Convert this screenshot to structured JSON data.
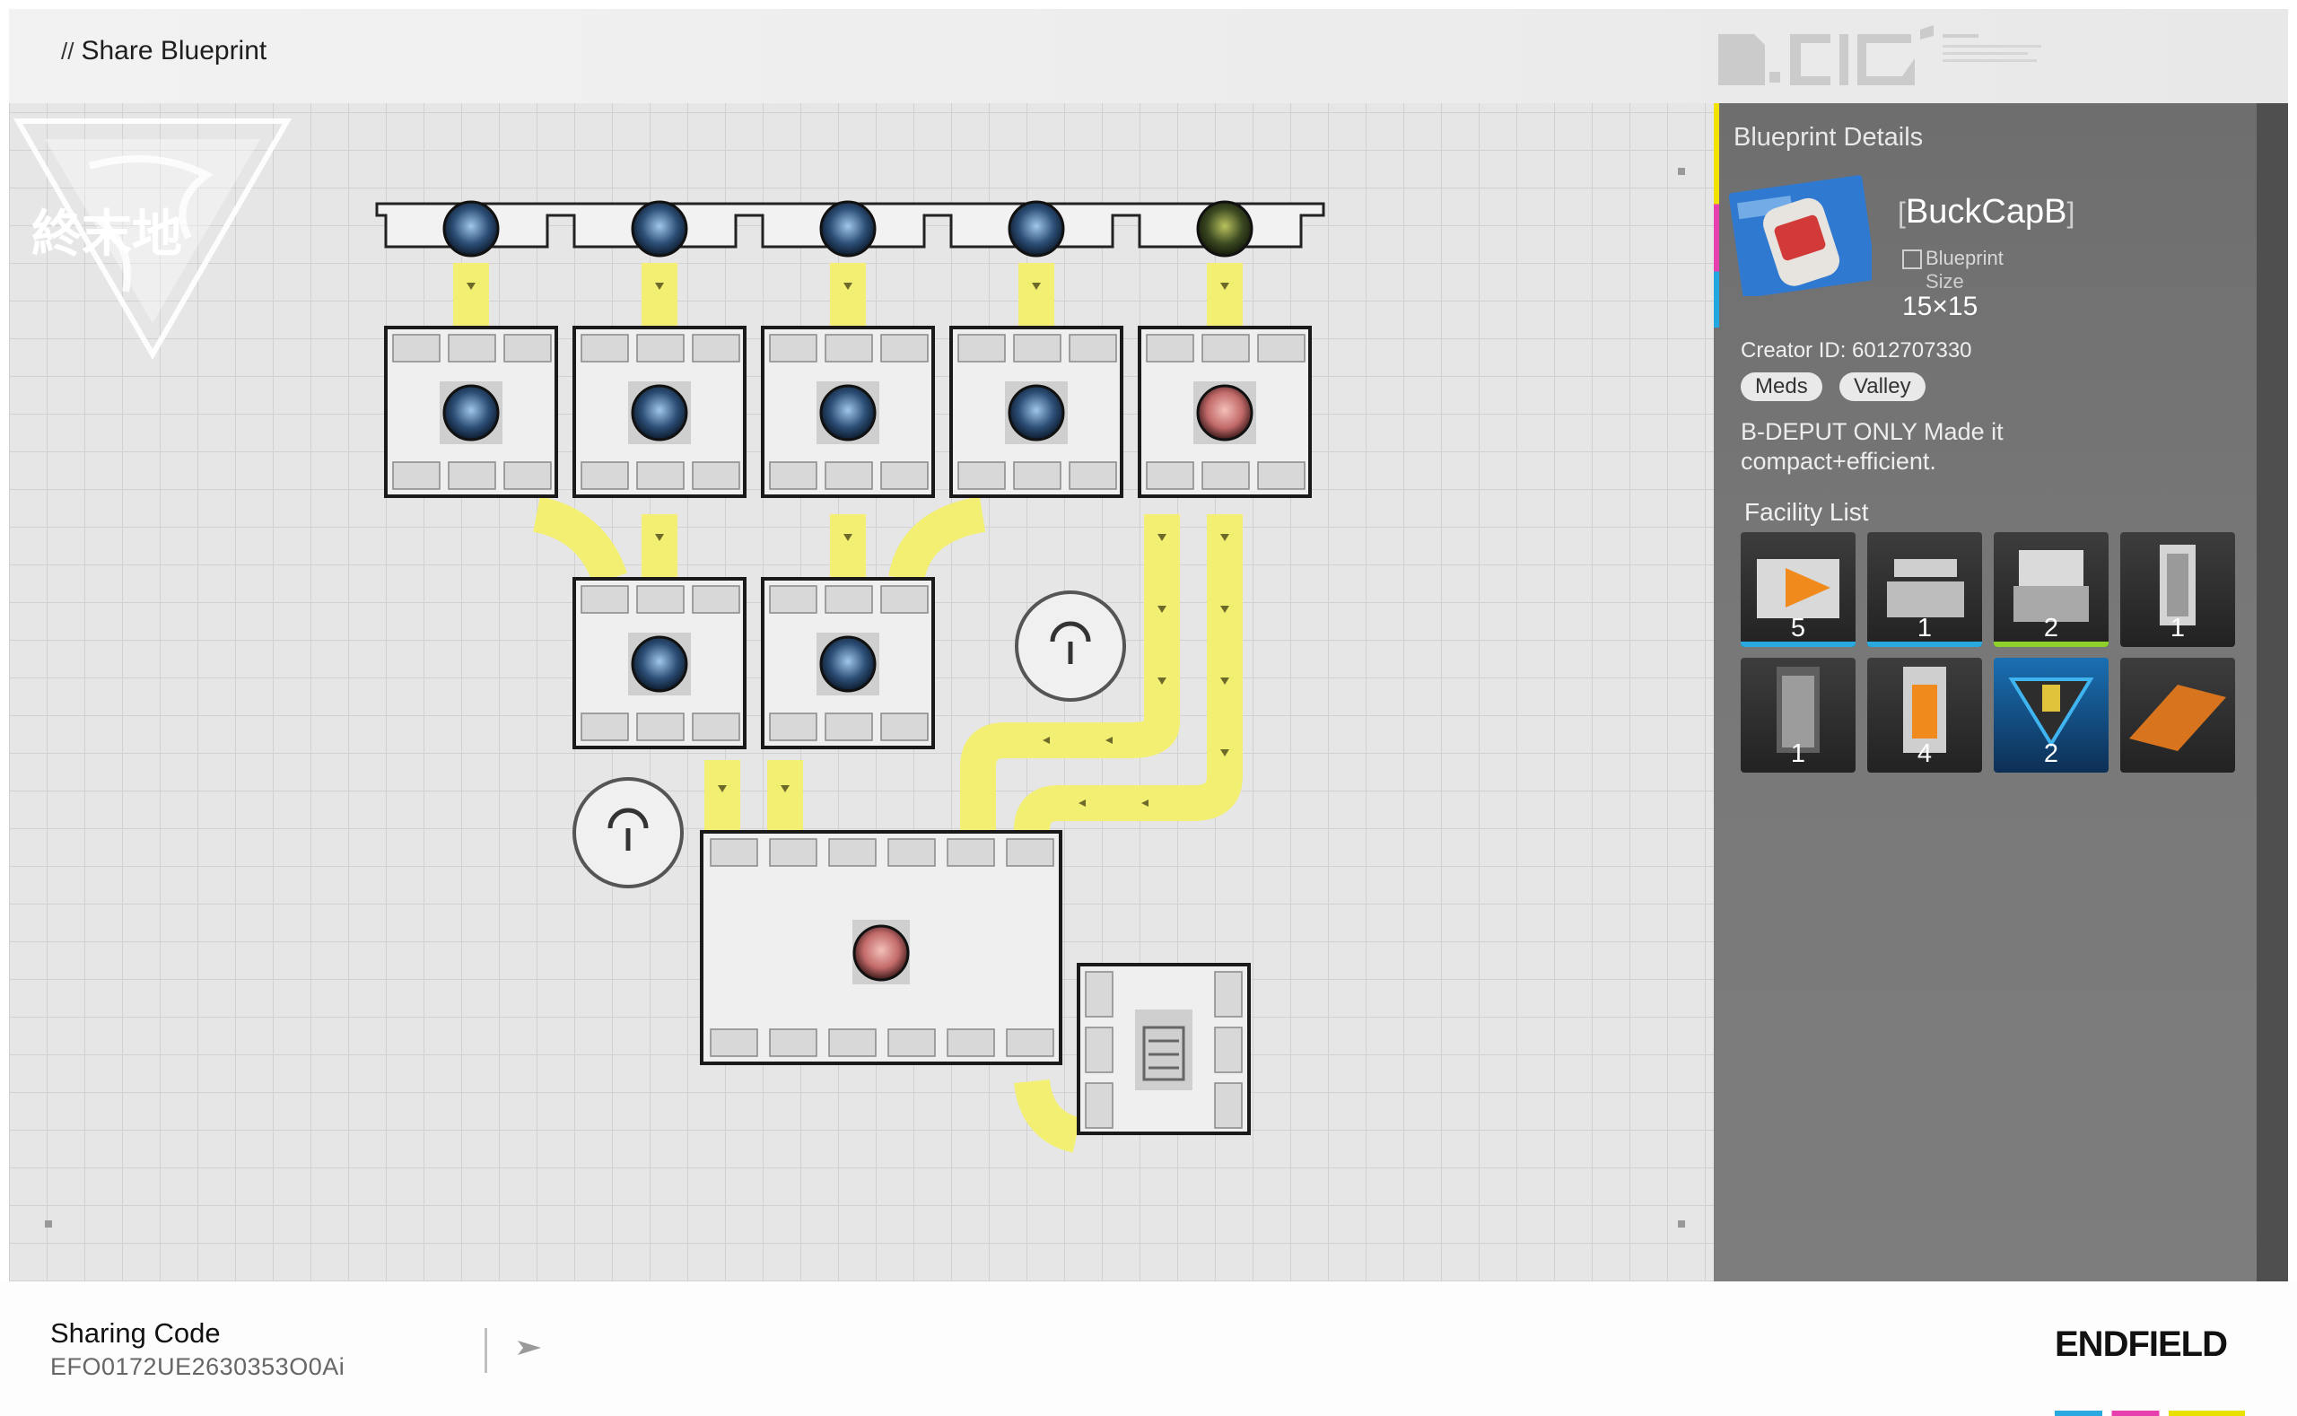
{
  "header": {
    "slashes": "//",
    "title": "Share Blueprint"
  },
  "panel": {
    "title": "Blueprint Details",
    "blueprint_name": "BuckCapB",
    "blueprint_type": "Blueprint",
    "size_label": "Size",
    "size_value": "15×15",
    "creator": "Creator ID: 6012707330",
    "tags": [
      "Meds",
      "Valley"
    ],
    "description": "B-DEPUT ONLY Made it compact+efficient.",
    "facility_list_title": "Facility List",
    "facilities": [
      {
        "icon": "refining-unit-icon",
        "count": "5",
        "bar": "#2aa9e0"
      },
      {
        "icon": "filling-unit-icon",
        "count": "1",
        "bar": "#2aa9e0"
      },
      {
        "icon": "packaging-unit-icon",
        "count": "2",
        "bar": "#8ed12b"
      },
      {
        "icon": "storage-tower-icon",
        "count": "1",
        "bar": ""
      },
      {
        "icon": "pillar-unit-icon",
        "count": "1",
        "bar": ""
      },
      {
        "icon": "fuel-tower-icon",
        "count": "4",
        "bar": ""
      },
      {
        "icon": "relay-tower-icon",
        "count": "2",
        "bar": ""
      },
      {
        "icon": "floor-plate-icon",
        "count": "",
        "bar": ""
      }
    ]
  },
  "footer": {
    "sharing_label": "Sharing Code",
    "sharing_code": "EFO0172UE2630353O0Ai",
    "logo_text": "ENDFIELD"
  },
  "colors": {
    "belt": "#f2ef72",
    "panel": "#737373",
    "accent_yellow": "#f2e200",
    "accent_pink": "#e83fae",
    "accent_blue": "#22a7e0"
  }
}
